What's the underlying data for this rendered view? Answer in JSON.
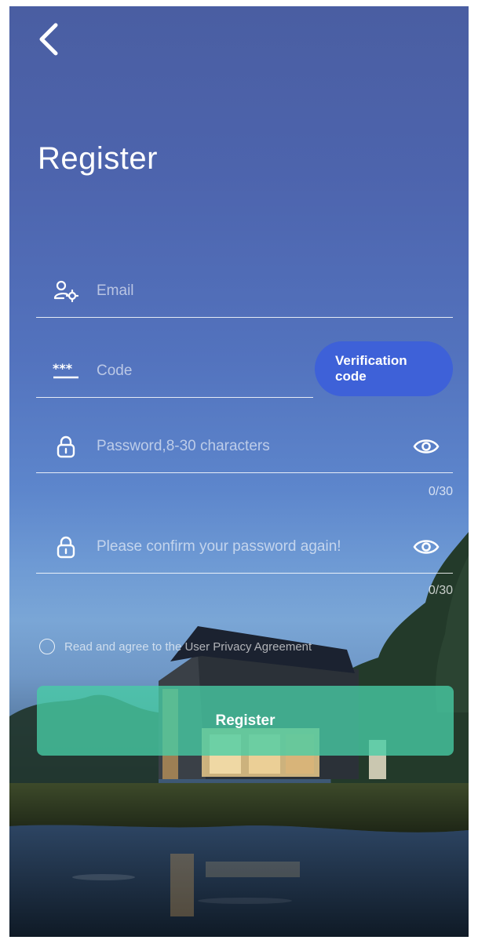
{
  "header": {
    "title": "Register",
    "back_icon": "chevron-left-icon"
  },
  "form": {
    "email": {
      "placeholder": "Email",
      "value": "",
      "icon": "user-settings-icon"
    },
    "code": {
      "placeholder": "Code",
      "value": "",
      "icon": "asterisk-code-icon"
    },
    "verify_button": {
      "line1": "Verification",
      "line2": "code"
    },
    "password": {
      "placeholder": "Password,8-30 characters",
      "value": "",
      "icon": "lock-icon",
      "counter": "0/30",
      "toggle_icon": "eye-icon"
    },
    "confirm": {
      "placeholder": "Please confirm your password again!",
      "value": "",
      "icon": "lock-icon",
      "counter": "0/30",
      "toggle_icon": "eye-icon"
    },
    "agreement": {
      "label": "Read and agree to the User Privacy Agreement",
      "checked": false
    },
    "submit_label": "Register"
  },
  "colors": {
    "verify_button": "#3e61d8",
    "register_button": "#48cda5",
    "text": "#ffffff"
  }
}
